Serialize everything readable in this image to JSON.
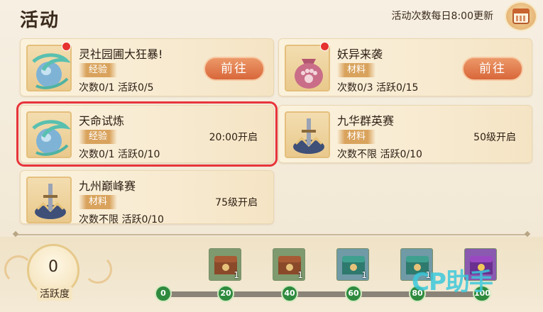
{
  "header": {
    "title": "活动",
    "refresh_text": "活动次数每日8:00更新"
  },
  "activities": [
    {
      "title": "灵社园圃大狂暴!",
      "tag": "经验",
      "stats": "次数0/1 活跃0/5",
      "action": "前往",
      "red_dot": true
    },
    {
      "title": "妖异来袭",
      "tag": "材料",
      "stats": "次数0/3 活跃0/15",
      "action": "前往",
      "red_dot": true
    },
    {
      "title": "天命试炼",
      "tag": "经验",
      "stats": "次数0/1 活跃0/10",
      "open": "20:00开启",
      "selected": true
    },
    {
      "title": "九华群英赛",
      "tag": "材料",
      "stats": "次数不限 活跃0/10",
      "open": "50级开启"
    },
    {
      "title": "九州巅峰赛",
      "tag": "材料",
      "stats": "次数不限 活跃0/10",
      "open": "75级开启"
    }
  ],
  "activity_points": {
    "value": "0",
    "label": "活跃度"
  },
  "milestones": [
    "0",
    "20",
    "40",
    "60",
    "80",
    "100"
  ],
  "rewards": [
    {
      "qty": "1",
      "kind": "brown-chest"
    },
    {
      "qty": "1",
      "kind": "brown-chest"
    },
    {
      "qty": "1",
      "kind": "jade-chest"
    },
    {
      "qty": "1",
      "kind": "jade-chest"
    },
    {
      "qty": "",
      "kind": "purple-chest"
    }
  ],
  "watermark": "CP助手",
  "colors": {
    "accent_button": "#d8673a",
    "tag_bg": "#d9a35d",
    "selected_outline": "#e8343b",
    "milestone_green": "#2e8a3e"
  }
}
